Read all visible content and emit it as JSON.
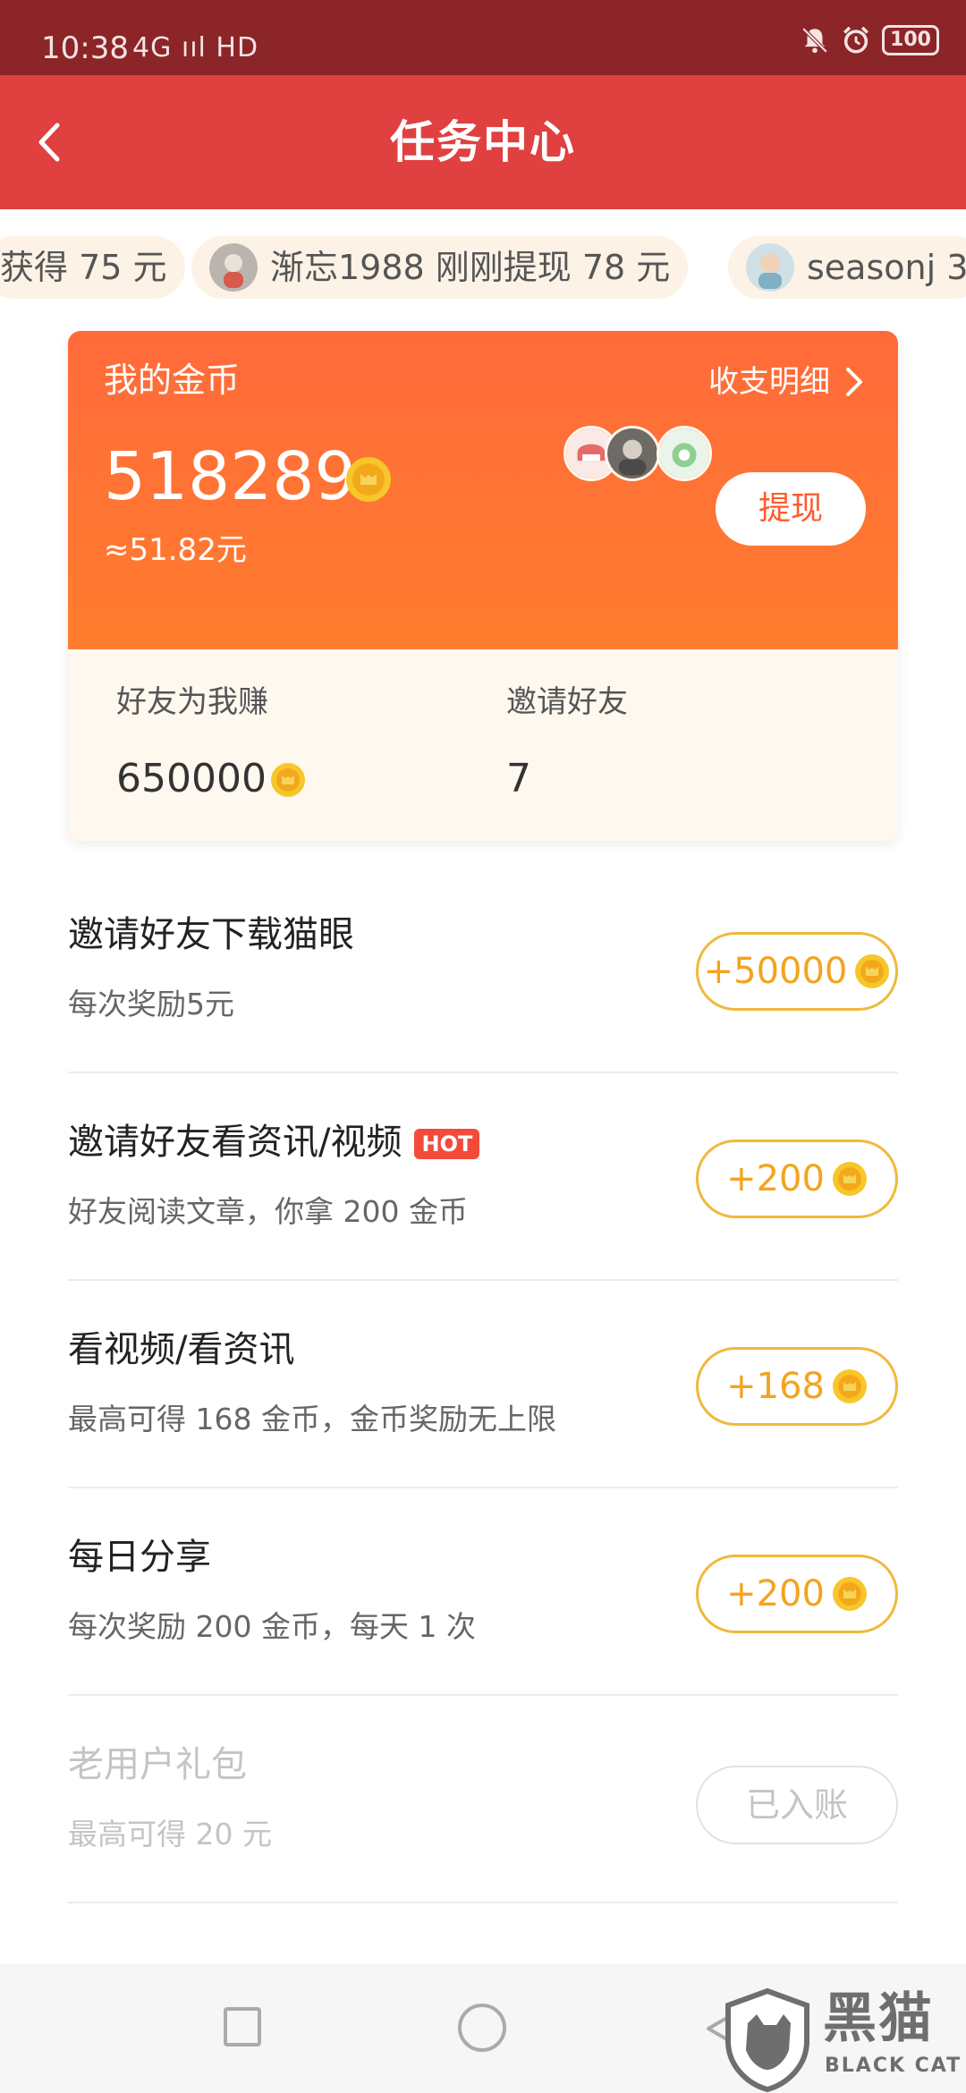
{
  "status_bar": {
    "time": "10:38",
    "network": "4G ııl HD",
    "battery": "100"
  },
  "nav": {
    "title": "任务中心"
  },
  "ticker": [
    {
      "text": "获得 75 元"
    },
    {
      "text": "渐忘1988 刚刚提现 78 元"
    },
    {
      "text": "seasonj 3"
    }
  ],
  "coin_card": {
    "label": "我的金币",
    "ledger_label": "收支明细",
    "balance": "518289",
    "yuan_value": "≈51.82元",
    "withdraw_label": "提现",
    "friends_earn_label": "好友为我赚",
    "friends_earn_value": "650000",
    "invite_label": "邀请好友",
    "invite_count": "7"
  },
  "tasks": [
    {
      "title": "邀请好友下载猫眼",
      "desc": "每次奖励5元",
      "reward": "+50000",
      "hot": ""
    },
    {
      "title": "邀请好友看资讯/视频",
      "desc": "好友阅读文章，你拿 200 金币",
      "reward": "+200",
      "hot": "HOT"
    },
    {
      "title": "看视频/看资讯",
      "desc": "最高可得 168 金币，金币奖励无上限",
      "reward": "+168",
      "hot": ""
    },
    {
      "title": "每日分享",
      "desc": "每次奖励 200 金币，每天 1 次",
      "reward": "+200",
      "hot": ""
    },
    {
      "title": "老用户礼包",
      "desc": "最高可得 20 元",
      "reward": "已入账",
      "hot": ""
    }
  ],
  "watermark": {
    "text": "黑猫",
    "sub": "BLACK CAT"
  },
  "colors": {
    "nav_red": "#e04040",
    "status_bar": "#8b2528",
    "coin_orange": "#ff6a3a",
    "reward_gold": "#f2a420"
  }
}
